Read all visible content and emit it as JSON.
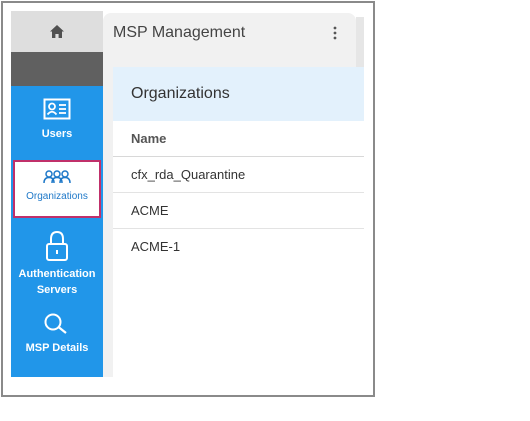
{
  "panel": {
    "title": "MSP Management"
  },
  "sidebar": {
    "items": [
      {
        "label": "Users",
        "icon": "id-card-icon"
      },
      {
        "label": "Organizations",
        "icon": "people-icon"
      },
      {
        "label": "Authentication Servers",
        "icon": "lock-icon"
      },
      {
        "label": "MSP Details",
        "icon": "magnifier-icon"
      }
    ]
  },
  "organizations": {
    "title": "Organizations",
    "column_header": "Name",
    "rows": [
      "cfx_rda_Quarantine",
      "ACME",
      "ACME-1"
    ]
  },
  "colors": {
    "nav_blue": "#2196e9",
    "selected_border": "#c0306a",
    "header_bg": "#e3f1fc"
  }
}
